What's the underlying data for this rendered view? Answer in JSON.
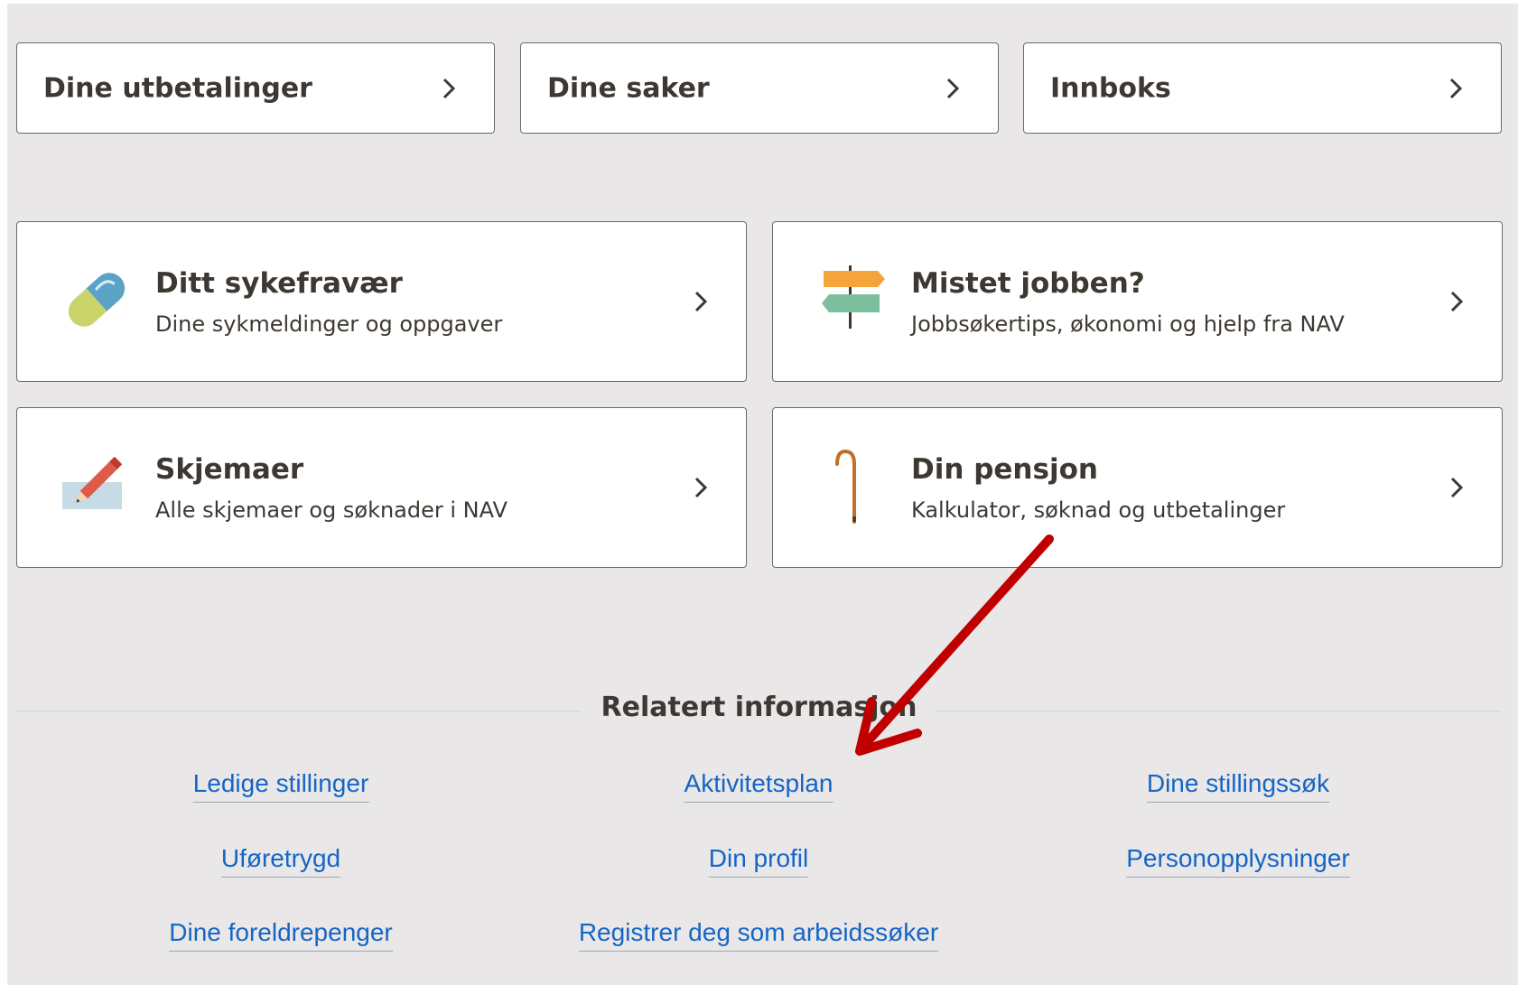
{
  "quick_links": [
    {
      "label": "Dine utbetalinger"
    },
    {
      "label": "Dine saker"
    },
    {
      "label": "Innboks"
    }
  ],
  "service_cards": [
    {
      "title": "Ditt sykefravær",
      "subtitle": "Dine sykmeldinger og oppgaver",
      "icon": "pill-icon"
    },
    {
      "title": "Mistet jobben?",
      "subtitle": "Jobbsøkertips, økonomi og hjelp fra NAV",
      "icon": "signpost-icon"
    },
    {
      "title": "Skjemaer",
      "subtitle": "Alle skjemaer og søknader i NAV",
      "icon": "pencil-form-icon"
    },
    {
      "title": "Din pensjon",
      "subtitle": "Kalkulator, søknad og utbetalinger",
      "icon": "cane-icon"
    }
  ],
  "related": {
    "heading": "Relatert informasjon",
    "links": [
      {
        "label": "Ledige stillinger"
      },
      {
        "label": "Aktivitetsplan"
      },
      {
        "label": "Dine stillingssøk"
      },
      {
        "label": "Uføretrygd"
      },
      {
        "label": "Din profil"
      },
      {
        "label": "Personopplysninger"
      },
      {
        "label": "Dine foreldrepenger"
      },
      {
        "label": "Registrer deg som arbeidssøker"
      }
    ]
  },
  "colors": {
    "background": "#e9e7e7",
    "card": "#ffffff",
    "text": "#3e3832",
    "link": "#1565c7",
    "annotation_arrow": "#c00000"
  }
}
